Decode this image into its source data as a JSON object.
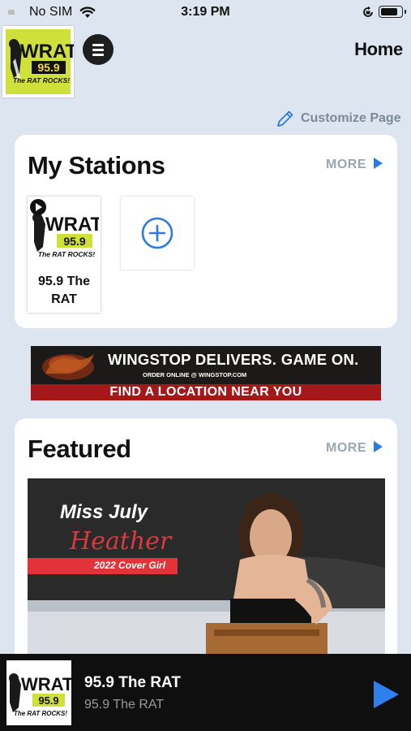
{
  "status_bar": {
    "carrier": "No SIM",
    "time": "3:19 PM"
  },
  "header": {
    "logo": {
      "text_top": "WRAT",
      "text_freq": "95.9",
      "tagline": "The RAT ROCKS!"
    },
    "title": "Home"
  },
  "customize": {
    "label": "Customize Page"
  },
  "my_stations": {
    "title": "My Stations",
    "more_label": "MORE",
    "stations": [
      {
        "name": "95.9 The RAT"
      }
    ]
  },
  "ad": {
    "headline": "WINGSTOP DELIVERS. GAME ON.",
    "subline": "ORDER ONLINE @ WINGSTOP.COM",
    "cta": "FIND A LOCATION NEAR YOU"
  },
  "featured": {
    "title": "Featured",
    "more_label": "MORE",
    "item": {
      "line1": "Miss July",
      "line2": "Heather",
      "line3": "2022 Cover Girl"
    }
  },
  "player": {
    "title": "95.9 The RAT",
    "subtitle": "95.9 The RAT"
  },
  "colors": {
    "accent": "#2c7be5",
    "background": "#dde6f0",
    "logo_yellow": "#cfe03a",
    "brand_red": "#e2333a"
  },
  "icons": [
    "wifi-icon",
    "rotation-lock-icon",
    "battery-icon",
    "menu-icon",
    "pencil-icon",
    "chevron-right-icon",
    "play-icon",
    "add-circle-icon"
  ]
}
